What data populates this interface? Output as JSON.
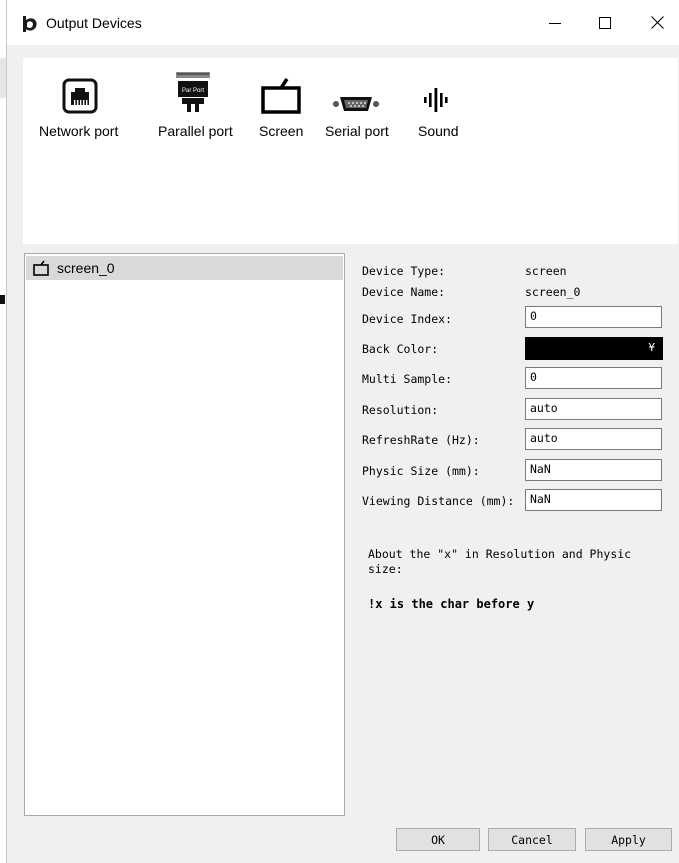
{
  "window": {
    "title": "Output Devices",
    "controls": {
      "minimize": "—",
      "maximize": "☐",
      "close": "✕"
    }
  },
  "toolbar": {
    "items": [
      {
        "label": "Network port",
        "icon": "network-port-icon"
      },
      {
        "label": "Parallel port",
        "icon": "parallel-port-icon",
        "icon_text": "Par Port"
      },
      {
        "label": "Screen",
        "icon": "screen-icon"
      },
      {
        "label": "Serial port",
        "icon": "serial-port-icon"
      },
      {
        "label": "Sound",
        "icon": "sound-icon"
      }
    ]
  },
  "device_list": {
    "items": [
      {
        "label": "screen_0",
        "icon": "screen-icon",
        "selected": true
      }
    ]
  },
  "properties": {
    "device_type": {
      "label": "Device Type:",
      "value": "screen"
    },
    "device_name": {
      "label": "Device Name:",
      "value": "screen_0"
    },
    "device_index": {
      "label": "Device Index:",
      "value": "0"
    },
    "back_color": {
      "label": "Back Color:",
      "value": "#000000",
      "arrow": "¥"
    },
    "multi_sample": {
      "label": "Multi Sample:",
      "value": "0"
    },
    "resolution": {
      "label": "Resolution:",
      "value": "auto"
    },
    "refresh_rate": {
      "label": "RefreshRate (Hz):",
      "value": "auto"
    },
    "physic_size": {
      "label": "Physic Size (mm):",
      "value": "NaN"
    },
    "viewing_distance": {
      "label": "Viewing Distance (mm):",
      "value": "NaN"
    }
  },
  "note": {
    "text": "About the \"x\" in Resolution and Physic size:",
    "bold": "!x is the char before y"
  },
  "buttons": {
    "ok": "OK",
    "cancel": "Cancel",
    "apply": "Apply"
  }
}
